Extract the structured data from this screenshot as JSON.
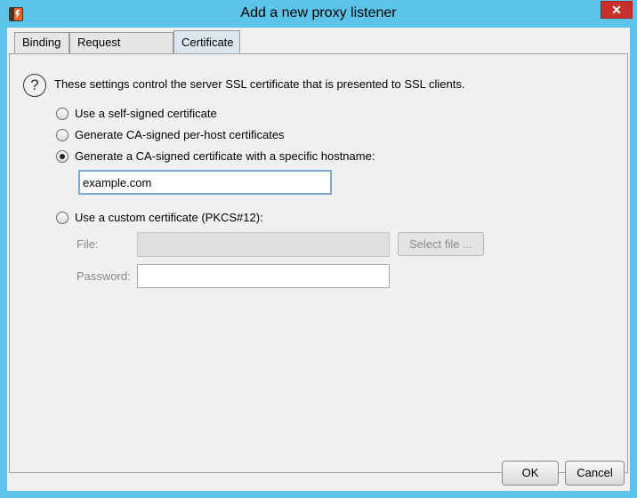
{
  "window": {
    "title": "Add a new proxy listener",
    "close_glyph": "✕"
  },
  "tabs": [
    {
      "label": "Binding",
      "active": false
    },
    {
      "label": "Request handling",
      "active": false
    },
    {
      "label": "Certificate",
      "active": true
    }
  ],
  "certificate": {
    "help_glyph": "?",
    "intro": "These settings control the server SSL certificate that is presented to SSL clients.",
    "options": [
      {
        "label": "Use a self-signed certificate",
        "checked": false
      },
      {
        "label": "Generate CA-signed per-host certificates",
        "checked": false
      },
      {
        "label": "Generate a CA-signed certificate with a specific hostname:",
        "checked": true
      },
      {
        "label": "Use a custom certificate (PKCS#12):",
        "checked": false
      }
    ],
    "hostname_value": "example.com",
    "file_label": "File:",
    "file_value": "",
    "select_file_label": "Select file ...",
    "password_label": "Password:",
    "password_value": ""
  },
  "buttons": {
    "ok": "OK",
    "cancel": "Cancel"
  },
  "colors": {
    "title_bar": "#5bc4e8",
    "close_button": "#c7302b",
    "app_icon_orange": "#e8662b"
  }
}
